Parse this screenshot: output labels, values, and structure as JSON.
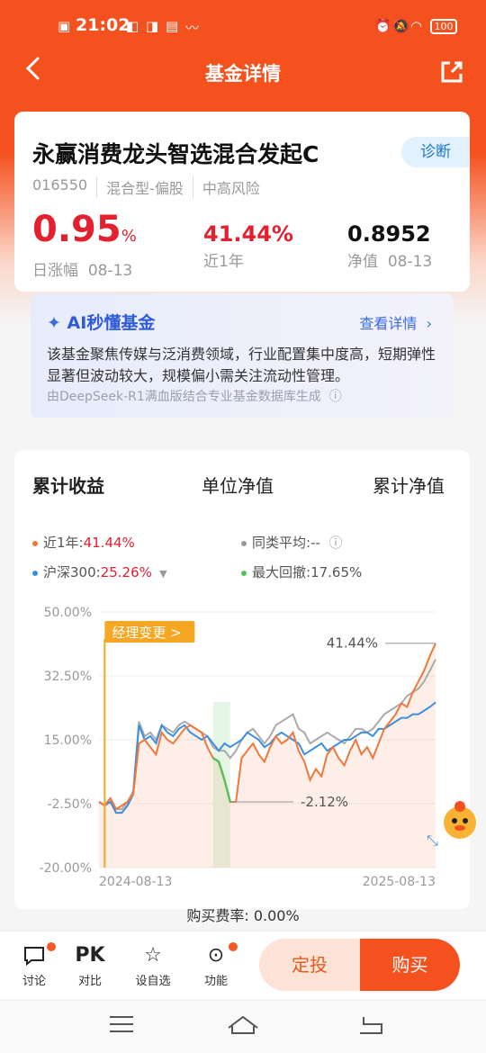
{
  "status_bar": {
    "time": "21:02",
    "battery": "100"
  },
  "header": {
    "title": "基金详情"
  },
  "fund": {
    "name": "永赢消费龙头智选混合发起C",
    "diagnose_label": "诊断",
    "code": "016550",
    "type": "混合型-偏股",
    "risk": "中高风险",
    "daily_change_value": "0.95",
    "daily_change_unit": "%",
    "daily_change_label": "日涨幅",
    "daily_change_date": "08-13",
    "one_year_value": "41.44%",
    "one_year_label": "近1年",
    "nav_value": "0.8952",
    "nav_label": "净值",
    "nav_date": "08-13"
  },
  "ai": {
    "title": "AI秒懂基金",
    "detail_link": "查看详情",
    "text": "该基金聚焦传媒与泛消费领域，行业配置集中度高，短期弹性显著但波动较大，规模偏小需关注流动性管理。",
    "source": "由DeepSeek-R1满血版结合专业基金数据库生成"
  },
  "chart_tabs": [
    "累计收益",
    "单位净值",
    "累计净值"
  ],
  "legend": {
    "fund_label": "近1年:",
    "fund_value": "41.44%",
    "peer_label": "同类平均:",
    "peer_value": "--",
    "index_label": "沪深300:",
    "index_value": "25.26%",
    "drawdown_label": "最大回撤:",
    "drawdown_value": "17.65%"
  },
  "colors": {
    "brand": "#f4511e",
    "fund_line": "#f0773a",
    "index_line": "#3b8fe0",
    "peer_line": "#aaaaaa",
    "drawdown": "#5ac05a",
    "up": "#e4202e"
  },
  "chart_data": {
    "type": "line",
    "x_start": "2024-08-13",
    "x_end": "2025-08-13",
    "y_ticks": [
      "50.00%",
      "32.50%",
      "15.00%",
      "-2.50%",
      "-20.00%"
    ],
    "ylim": [
      -20,
      50
    ],
    "manager_change_label": "经理变更 >",
    "end_label": "41.44%",
    "min_label": "-2.12%",
    "series": [
      {
        "name": "近1年",
        "values": [
          -2,
          -3,
          -1,
          -4,
          -3,
          -2,
          0,
          14,
          15,
          13,
          11,
          17,
          15,
          14,
          16,
          18,
          19,
          18,
          17,
          13,
          10,
          9,
          4,
          -2,
          -2,
          10,
          12,
          14,
          11,
          9,
          13,
          16,
          14,
          15,
          17,
          12,
          9,
          4,
          7,
          5,
          11,
          13,
          10,
          8,
          12,
          15,
          11,
          13,
          10,
          14,
          18,
          20,
          22,
          25,
          24,
          28,
          31,
          34,
          38,
          41.44
        ]
      },
      {
        "name": "沪深300",
        "values": [
          -2,
          -3,
          -2,
          -5,
          -5,
          -3,
          0,
          19,
          15,
          16,
          14,
          19,
          17,
          16,
          18,
          19,
          17,
          16,
          15,
          16,
          14,
          12,
          14,
          13,
          14,
          15,
          17,
          16,
          15,
          13,
          14,
          16,
          17,
          16,
          15,
          14,
          11,
          12,
          13,
          14,
          12,
          13,
          14,
          15,
          15,
          16,
          17,
          17,
          16,
          18,
          18,
          19,
          20,
          21,
          21,
          22,
          22,
          23,
          24,
          25.26
        ]
      },
      {
        "name": "同类平均",
        "values": [
          -2,
          -3,
          -1,
          -4,
          -4,
          -2,
          1,
          20,
          16,
          17,
          15,
          19,
          18,
          17,
          19,
          20,
          19,
          18,
          17,
          16,
          13,
          12,
          12,
          10,
          12,
          15,
          17,
          18,
          16,
          14,
          16,
          19,
          20,
          21,
          22,
          18,
          17,
          14,
          15,
          16,
          17,
          16,
          15,
          14,
          16,
          18,
          18,
          17,
          18,
          20,
          22,
          23,
          24,
          25,
          27,
          28,
          29,
          31,
          34,
          37
        ]
      }
    ]
  }
}
